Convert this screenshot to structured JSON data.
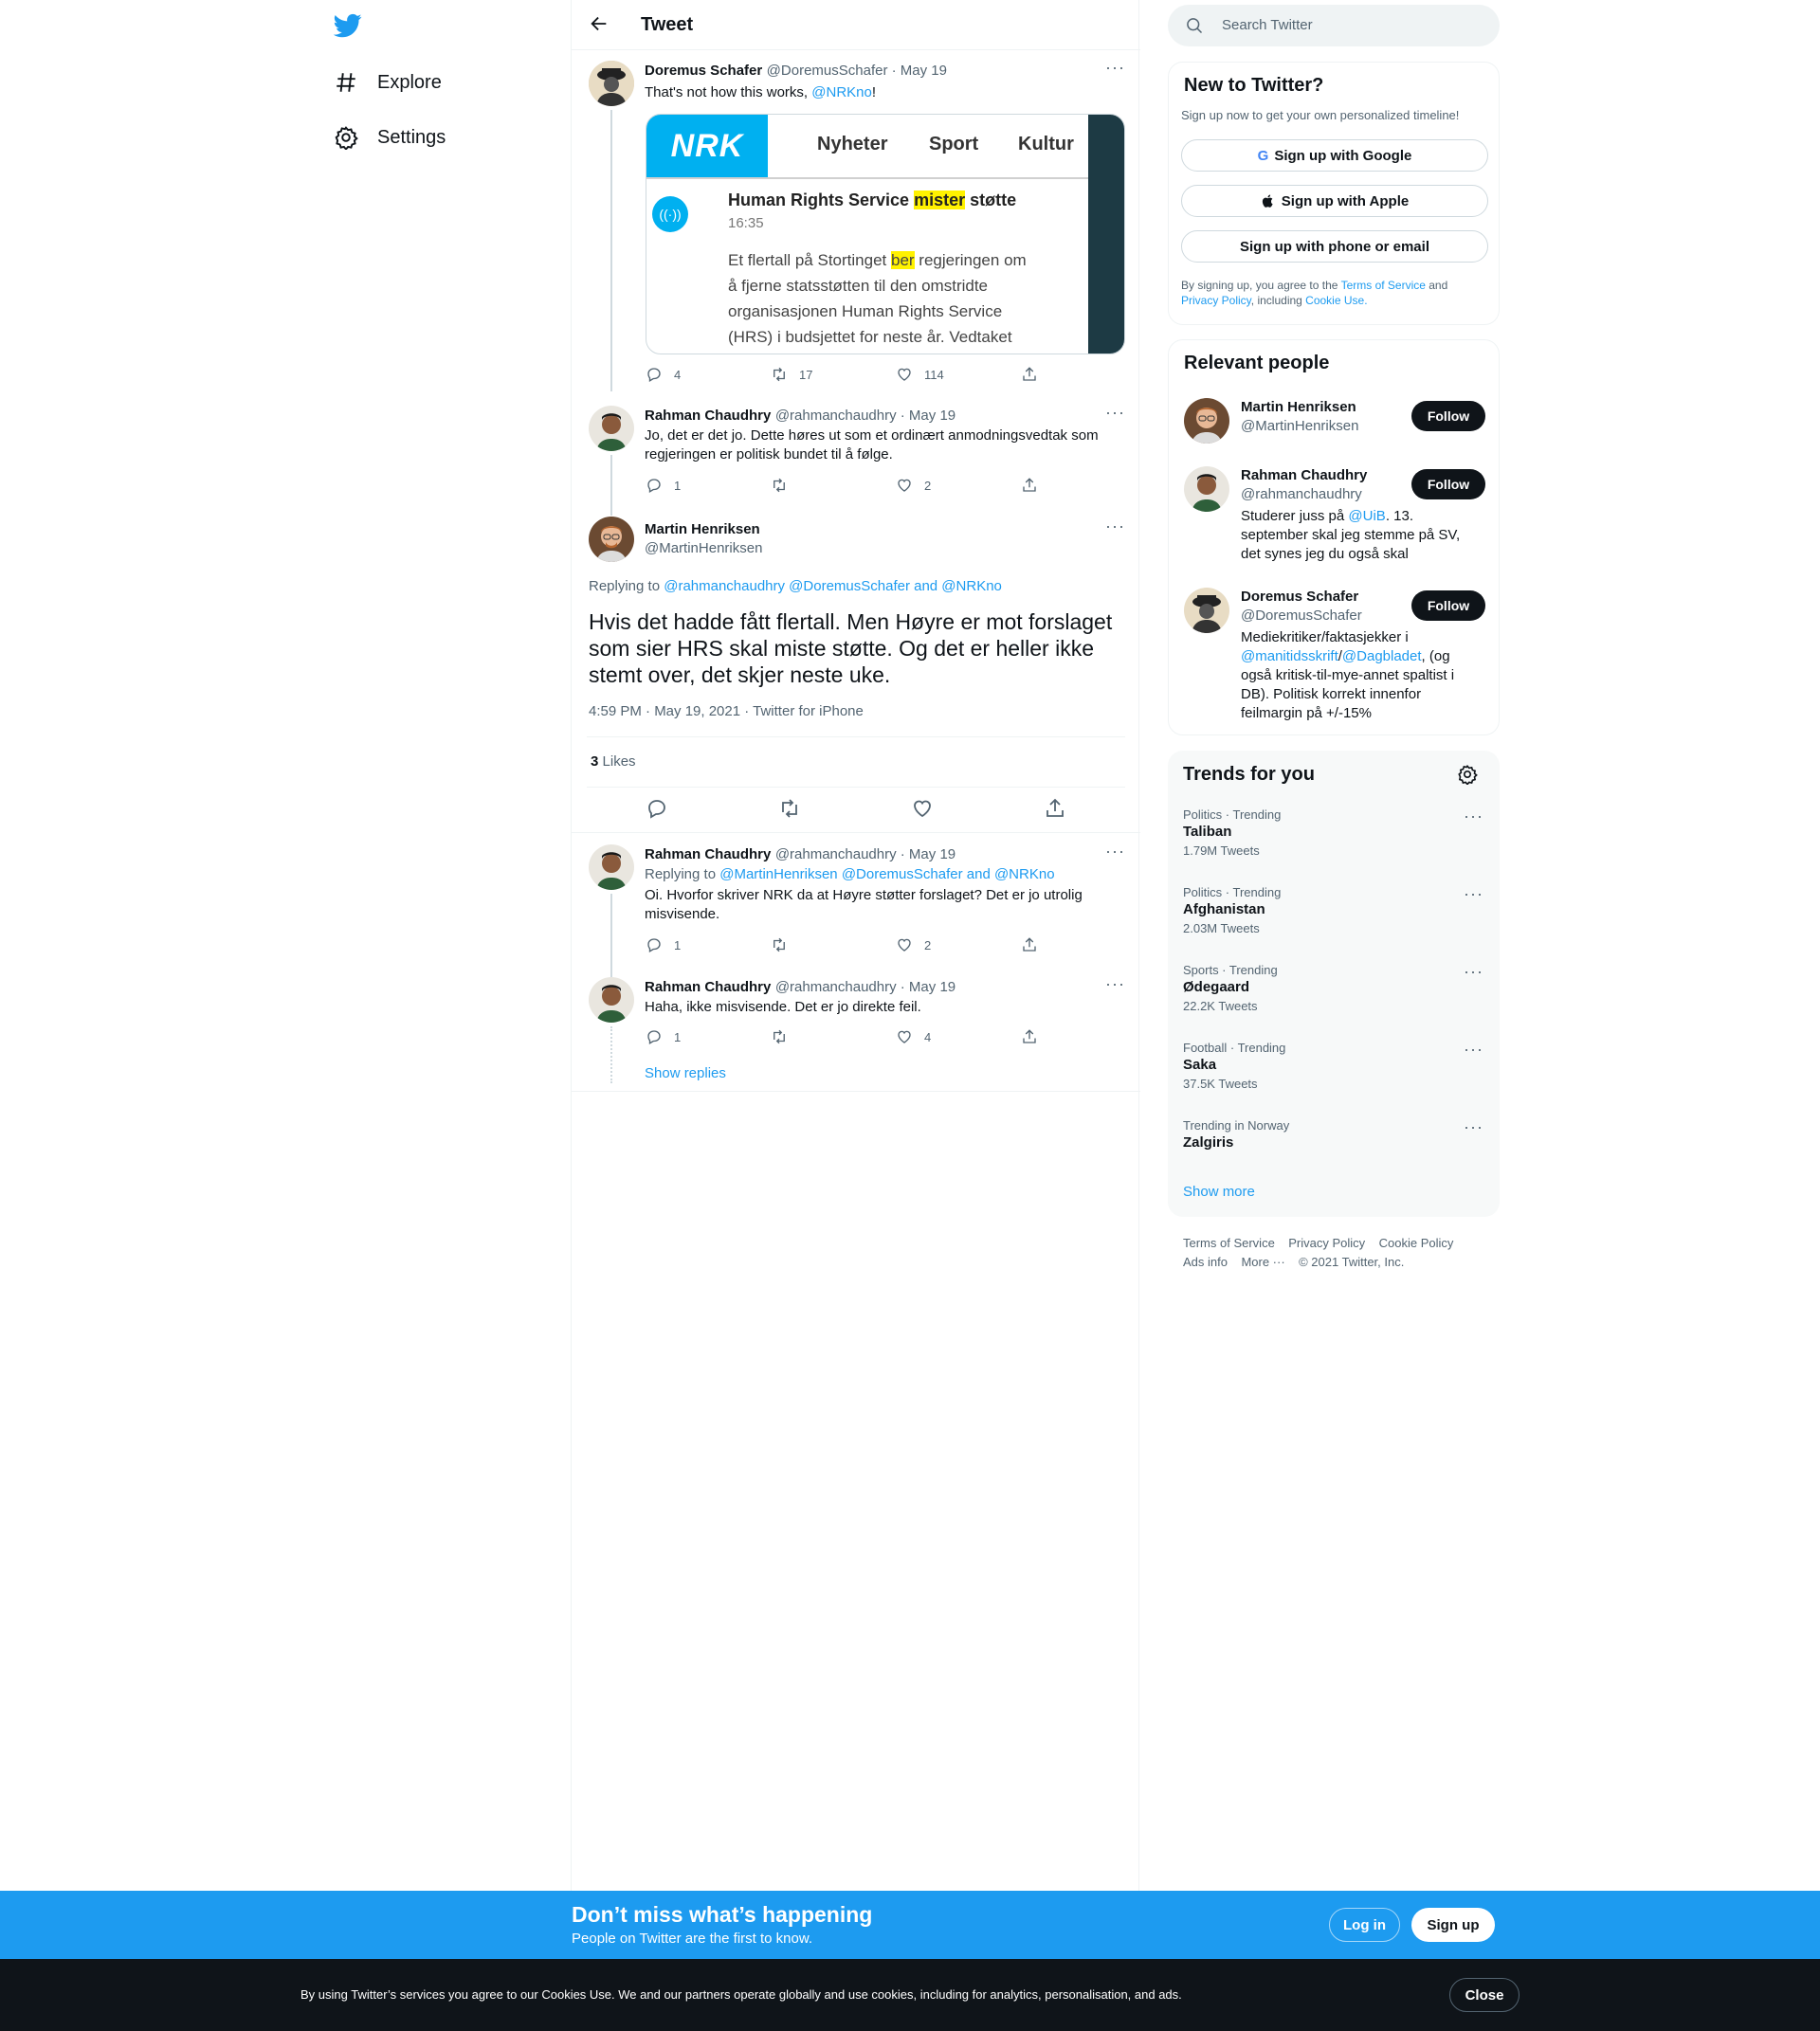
{
  "nav": {
    "explore": "Explore",
    "settings": "Settings"
  },
  "header": {
    "title": "Tweet"
  },
  "tweets": [
    {
      "name": "Doremus Schafer",
      "meta": "@DoremusSchafer · May 19",
      "text_prefix": "That's not how this works, ",
      "text_mention": "@NRKno",
      "text_suffix": "!",
      "replies": "4",
      "retweets": "17",
      "likes": "114"
    },
    {
      "name": "Rahman Chaudhry",
      "meta": "@rahmanchaudhry · May 19",
      "text": "Jo, det er det jo. Dette høres ut som et ordinært anmodningsvedtak som regjeringen er politisk bundet til å følge.",
      "replies": "1",
      "retweets": "",
      "likes": "2"
    }
  ],
  "embed": {
    "logo": "NRK",
    "tabs": [
      "Nyheter",
      "Sport",
      "Kultur"
    ],
    "headline_pre": "Human Rights Service ",
    "headline_hl": "mister",
    "headline_post": " støtte",
    "time": "16:35",
    "body_1_pre": "Et flertall på Stortinget ",
    "body_1_hl": "ber",
    "body_1_post": " regjeringen om",
    "body_2": "å fjerne statsstøtten til den omstridte",
    "body_3": "organisasjonen Human Rights Service",
    "body_4": "(HRS) i budsjettet for neste år. Vedtaket"
  },
  "main_tweet": {
    "name": "Martin Henriksen",
    "handle": "@MartinHenriksen",
    "replying_label": "Replying to ",
    "replying_to": "@rahmanchaudhry @DoremusSchafer and @NRKno",
    "text": "Hvis det hadde fått flertall. Men Høyre er mot forslaget som sier HRS skal miste støtte. Og det er heller ikke stemt over, det skjer neste uke.",
    "timestamp": "4:59 PM · May 19, 2021 · Twitter for iPhone",
    "likes_count": "3",
    "likes_label": "Likes"
  },
  "replies": [
    {
      "name": "Rahman Chaudhry",
      "meta": "@rahmanchaudhry · May 19",
      "replying_label": "Replying to ",
      "replying_to": "@MartinHenriksen @DoremusSchafer and @NRKno",
      "text": "Oi. Hvorfor skriver NRK da at Høyre støtter forslaget? Det er jo utrolig misvisende.",
      "replies": "1",
      "retweets": "",
      "likes": "2"
    },
    {
      "name": "Rahman Chaudhry",
      "meta": "@rahmanchaudhry · May 19",
      "text": "Haha, ikke misvisende. Det er jo direkte feil.",
      "replies": "1",
      "retweets": "",
      "likes": "4"
    }
  ],
  "show_replies": "Show replies",
  "search": {
    "placeholder": "Search Twitter"
  },
  "signup_card": {
    "title": "New to Twitter?",
    "subtitle": "Sign up now to get your own personalized timeline!",
    "google": "Sign up with Google",
    "apple": "Sign up with Apple",
    "phone": "Sign up with phone or email",
    "legal_1": "By signing up, you agree to the ",
    "tos": "Terms of Service",
    "legal_2": " and",
    "privacy": "Privacy Policy",
    "legal_3": ", including ",
    "cookie": "Cookie Use."
  },
  "relevant": {
    "title": "Relevant people",
    "follow_label": "Follow",
    "people": [
      {
        "name": "Martin Henriksen",
        "handle": "@MartinHenriksen"
      },
      {
        "name": "Rahman Chaudhry",
        "handle": "@rahmanchaudhry",
        "bio_1": "Studerer juss på ",
        "bio_link": "@UiB",
        "bio_2": ". 13. september skal jeg stemme på SV, det synes jeg du også skal"
      },
      {
        "name": "Doremus Schafer",
        "handle": "@DoremusSchafer",
        "bio_1": "Mediekritiker/faktasjekker i ",
        "bio_link1": "@manitidsskrift",
        "bio_sep": "/",
        "bio_link2": "@Dagbladet",
        "bio_2": ", (og også kritisk-til-mye-annet spaltist i DB). Politisk korrekt innenfor feilmargin på +/-15%"
      }
    ]
  },
  "trends": {
    "title": "Trends for you",
    "items": [
      {
        "category": "Politics · Trending",
        "name": "Taliban",
        "count": "1.79M Tweets"
      },
      {
        "category": "Politics · Trending",
        "name": "Afghanistan",
        "count": "2.03M Tweets"
      },
      {
        "category": "Sports · Trending",
        "name": "Ødegaard",
        "count": "22.2K Tweets"
      },
      {
        "category": "Football · Trending",
        "name": "Saka",
        "count": "37.5K Tweets"
      },
      {
        "category": "Trending in Norway",
        "name": "Zalgiris",
        "count": ""
      }
    ],
    "show_more": "Show more"
  },
  "footer": {
    "links": [
      "Terms of Service",
      "Privacy Policy",
      "Cookie Policy",
      "Ads info",
      "More ···"
    ],
    "copyright": "© 2021 Twitter, Inc."
  },
  "bottom_bar": {
    "title": "Don’t miss what’s happening",
    "subtitle": "People on Twitter are the first to know.",
    "login": "Log in",
    "signup": "Sign up"
  },
  "cookie_bar": {
    "text": "By using Twitter’s services you agree to our Cookies Use. We and our partners operate globally and use cookies, including for analytics, personalisation, and ads.",
    "close": "Close"
  },
  "colors": {
    "accent": "#1d9bf0",
    "text": "#0f1419",
    "secondary": "#536471",
    "nrk_blue": "#00b0f0",
    "highlight": "#fff200"
  }
}
